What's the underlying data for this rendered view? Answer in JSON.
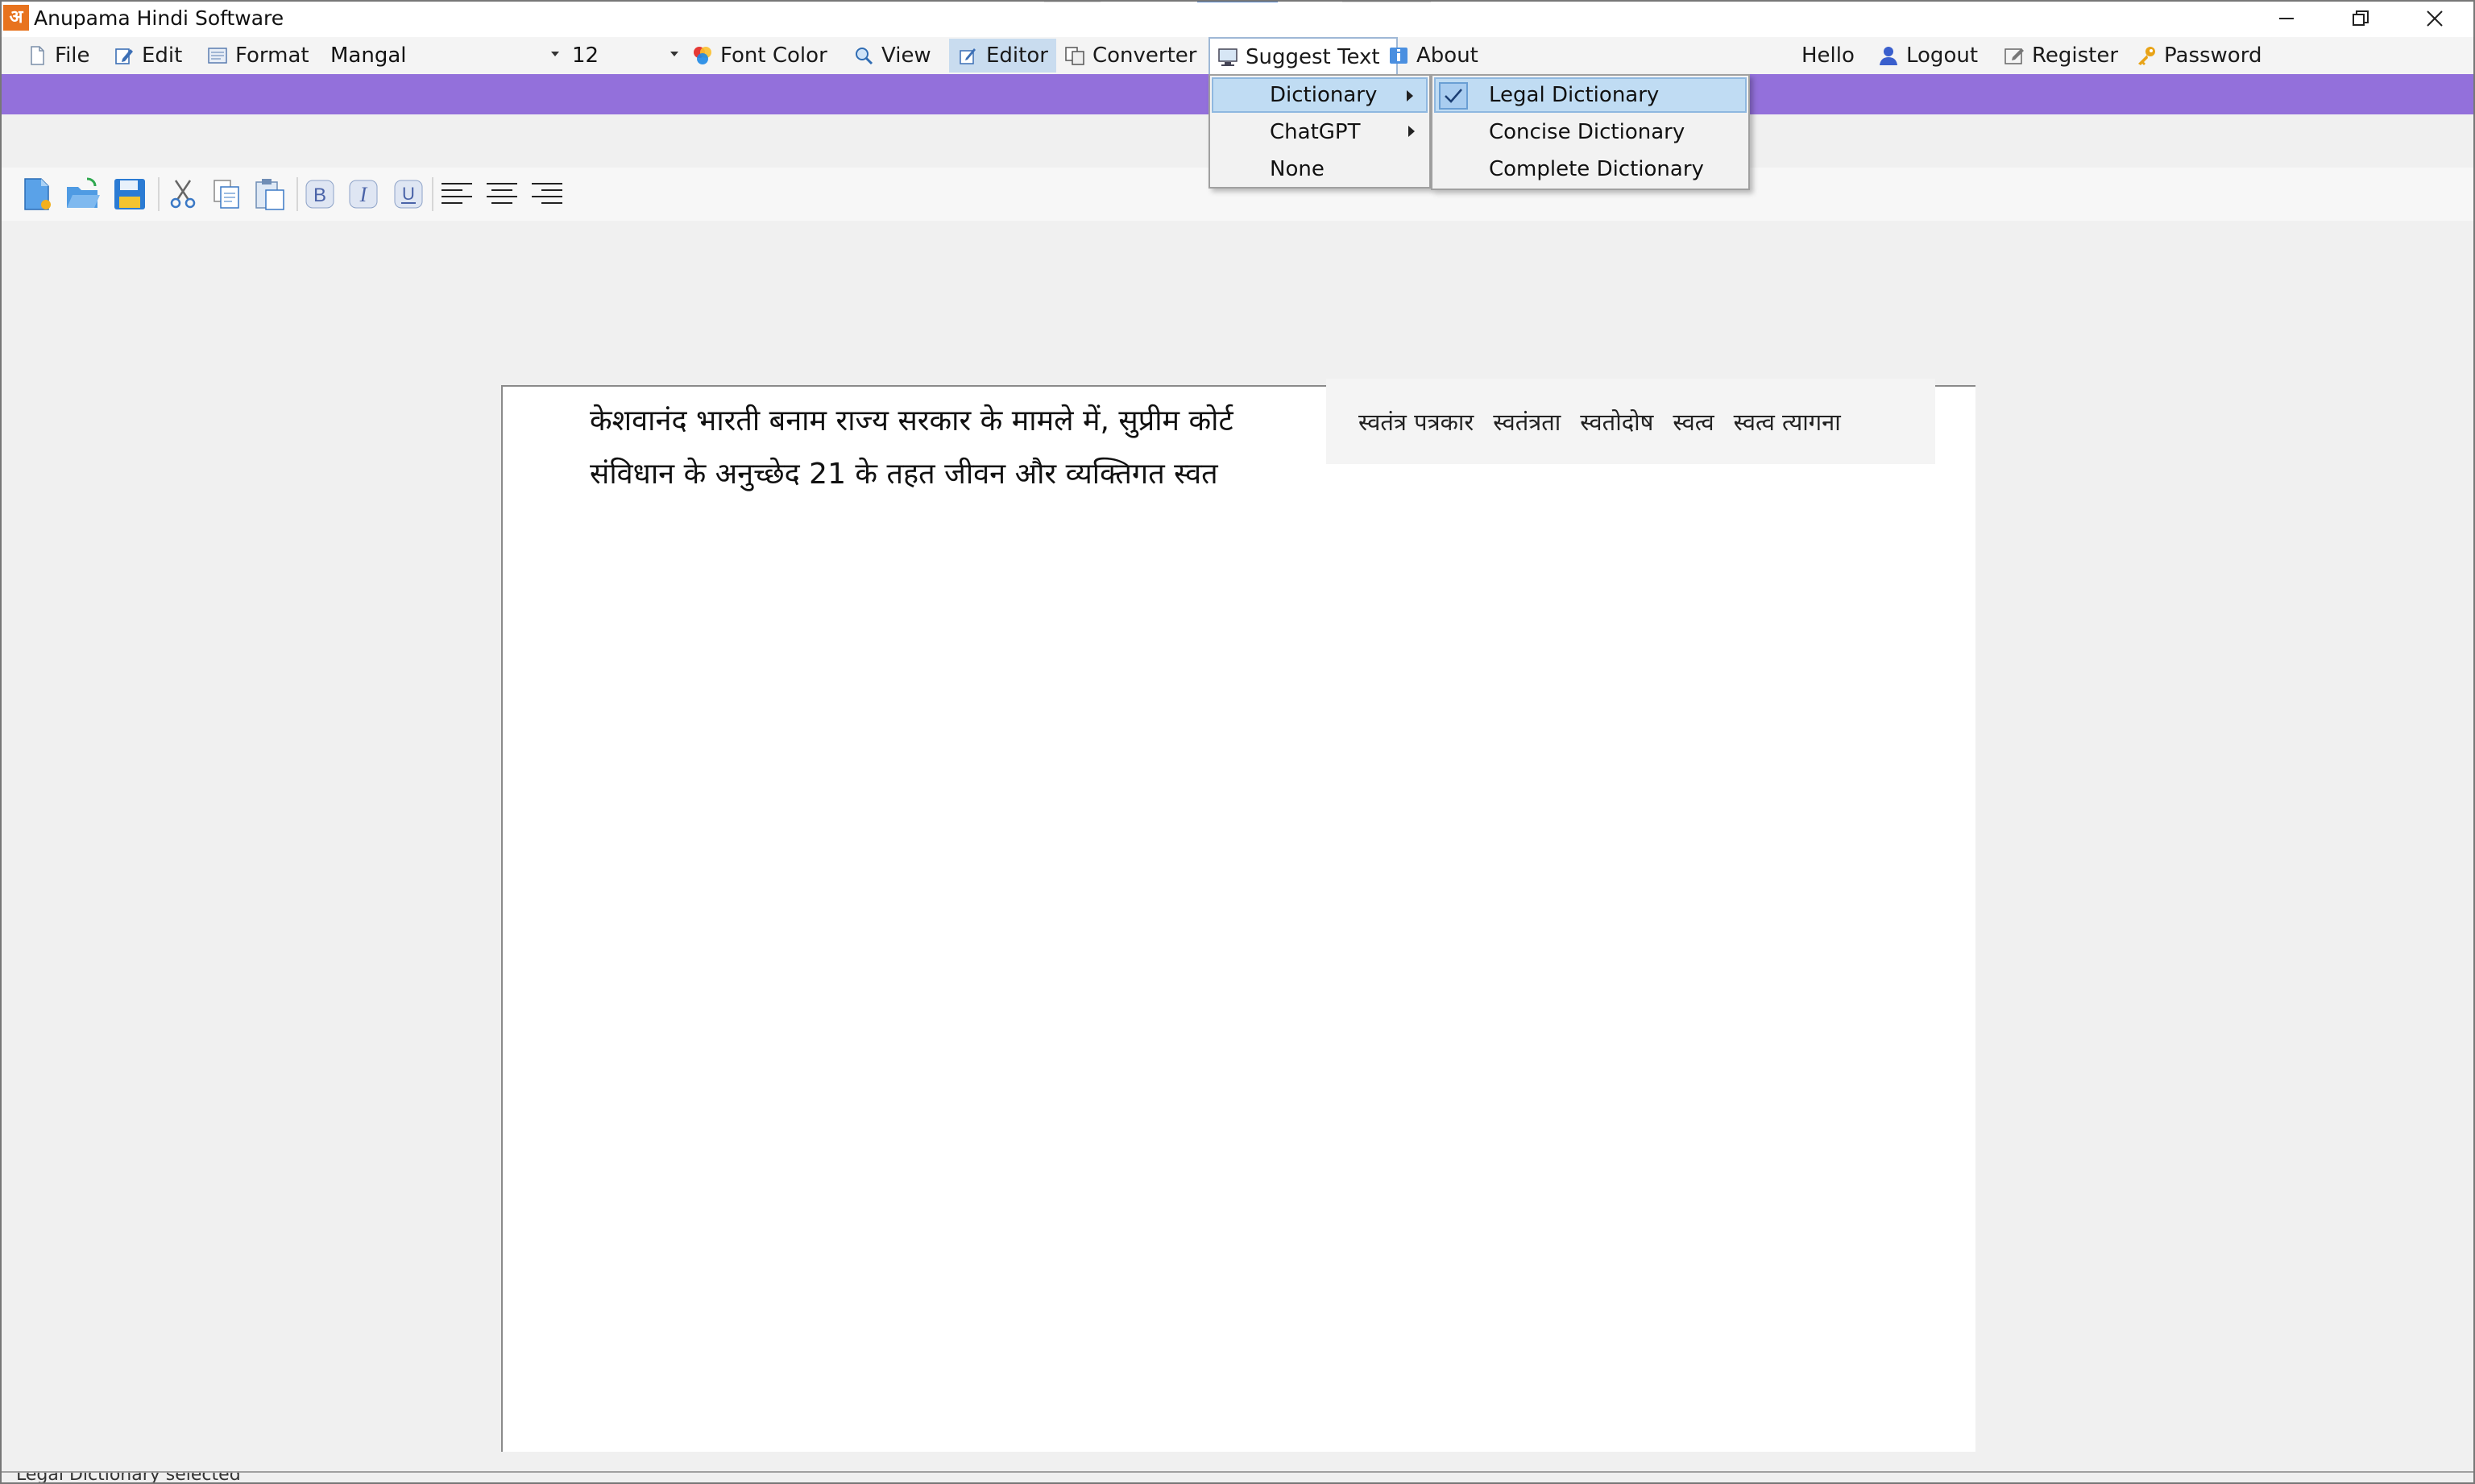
{
  "window": {
    "title": "Anupama Hindi Software",
    "app_icon_glyph": "अ"
  },
  "menubar": {
    "file": "File",
    "edit": "Edit",
    "format": "Format",
    "font_name": "Mangal",
    "font_size": "12",
    "font_color": "Font Color",
    "view": "View",
    "editor": "Editor",
    "converter": "Converter",
    "suggest_text": "Suggest Text",
    "about": "About",
    "hello": "Hello",
    "logout": "Logout",
    "register": "Register",
    "password": "Password"
  },
  "suggest_menu": {
    "items": [
      "Dictionary",
      "ChatGPT",
      "None"
    ]
  },
  "dictionary_submenu": {
    "items": [
      "Legal Dictionary",
      "Concise Dictionary",
      "Complete Dictionary"
    ],
    "checked": "Legal Dictionary"
  },
  "document": {
    "line1": "केशवानंद भारती बनाम राज्य सरकार के मामले में, सुप्रीम कोर्ट",
    "line2": "संविधान के अनुच्छेद 21 के तहत जीवन और व्यक्तिगत स्वत"
  },
  "suggestions": [
    "स्वतंत्र पत्रकार",
    "स्वतंत्रता",
    "स्वतोदोष",
    "स्वत्व",
    "स्वत्व त्यागना"
  ],
  "statusbar": {
    "text": "Legal Dictionary selected"
  },
  "colors": {
    "band": "#9370db",
    "menu_highlight": "#c0dcf3",
    "app_icon": "#e8731e"
  }
}
